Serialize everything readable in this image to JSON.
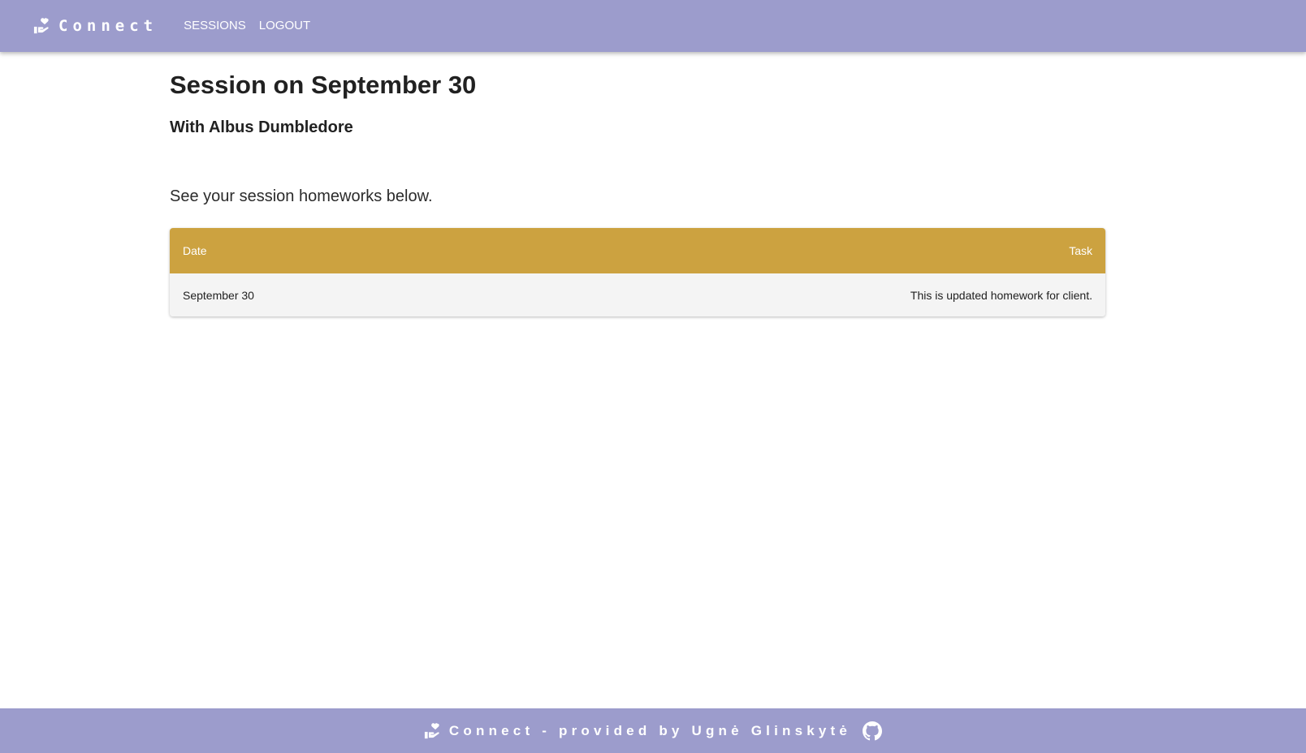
{
  "navbar": {
    "brand_icon": "hand-holding-heart-icon",
    "brand_text": "Connect",
    "links": [
      {
        "label": "SESSIONS"
      },
      {
        "label": "LOGOUT"
      }
    ]
  },
  "main": {
    "title": "Session on September 30",
    "subtitle": "With Albus Dumbledore",
    "intro": "See your session homeworks below.",
    "table": {
      "columns": [
        "Date",
        "Task"
      ],
      "rows": [
        {
          "date": "September 30",
          "task": "This is updated homework for client."
        }
      ]
    }
  },
  "footer": {
    "icon": "hand-holding-heart-icon",
    "text": "Connect - provided by Ugnė Glinskytė",
    "link_icon": "github-icon"
  },
  "colors": {
    "nav_bg": "#9c9ccc",
    "table_header_bg": "#cca240",
    "row_bg": "#f4f4f4"
  }
}
